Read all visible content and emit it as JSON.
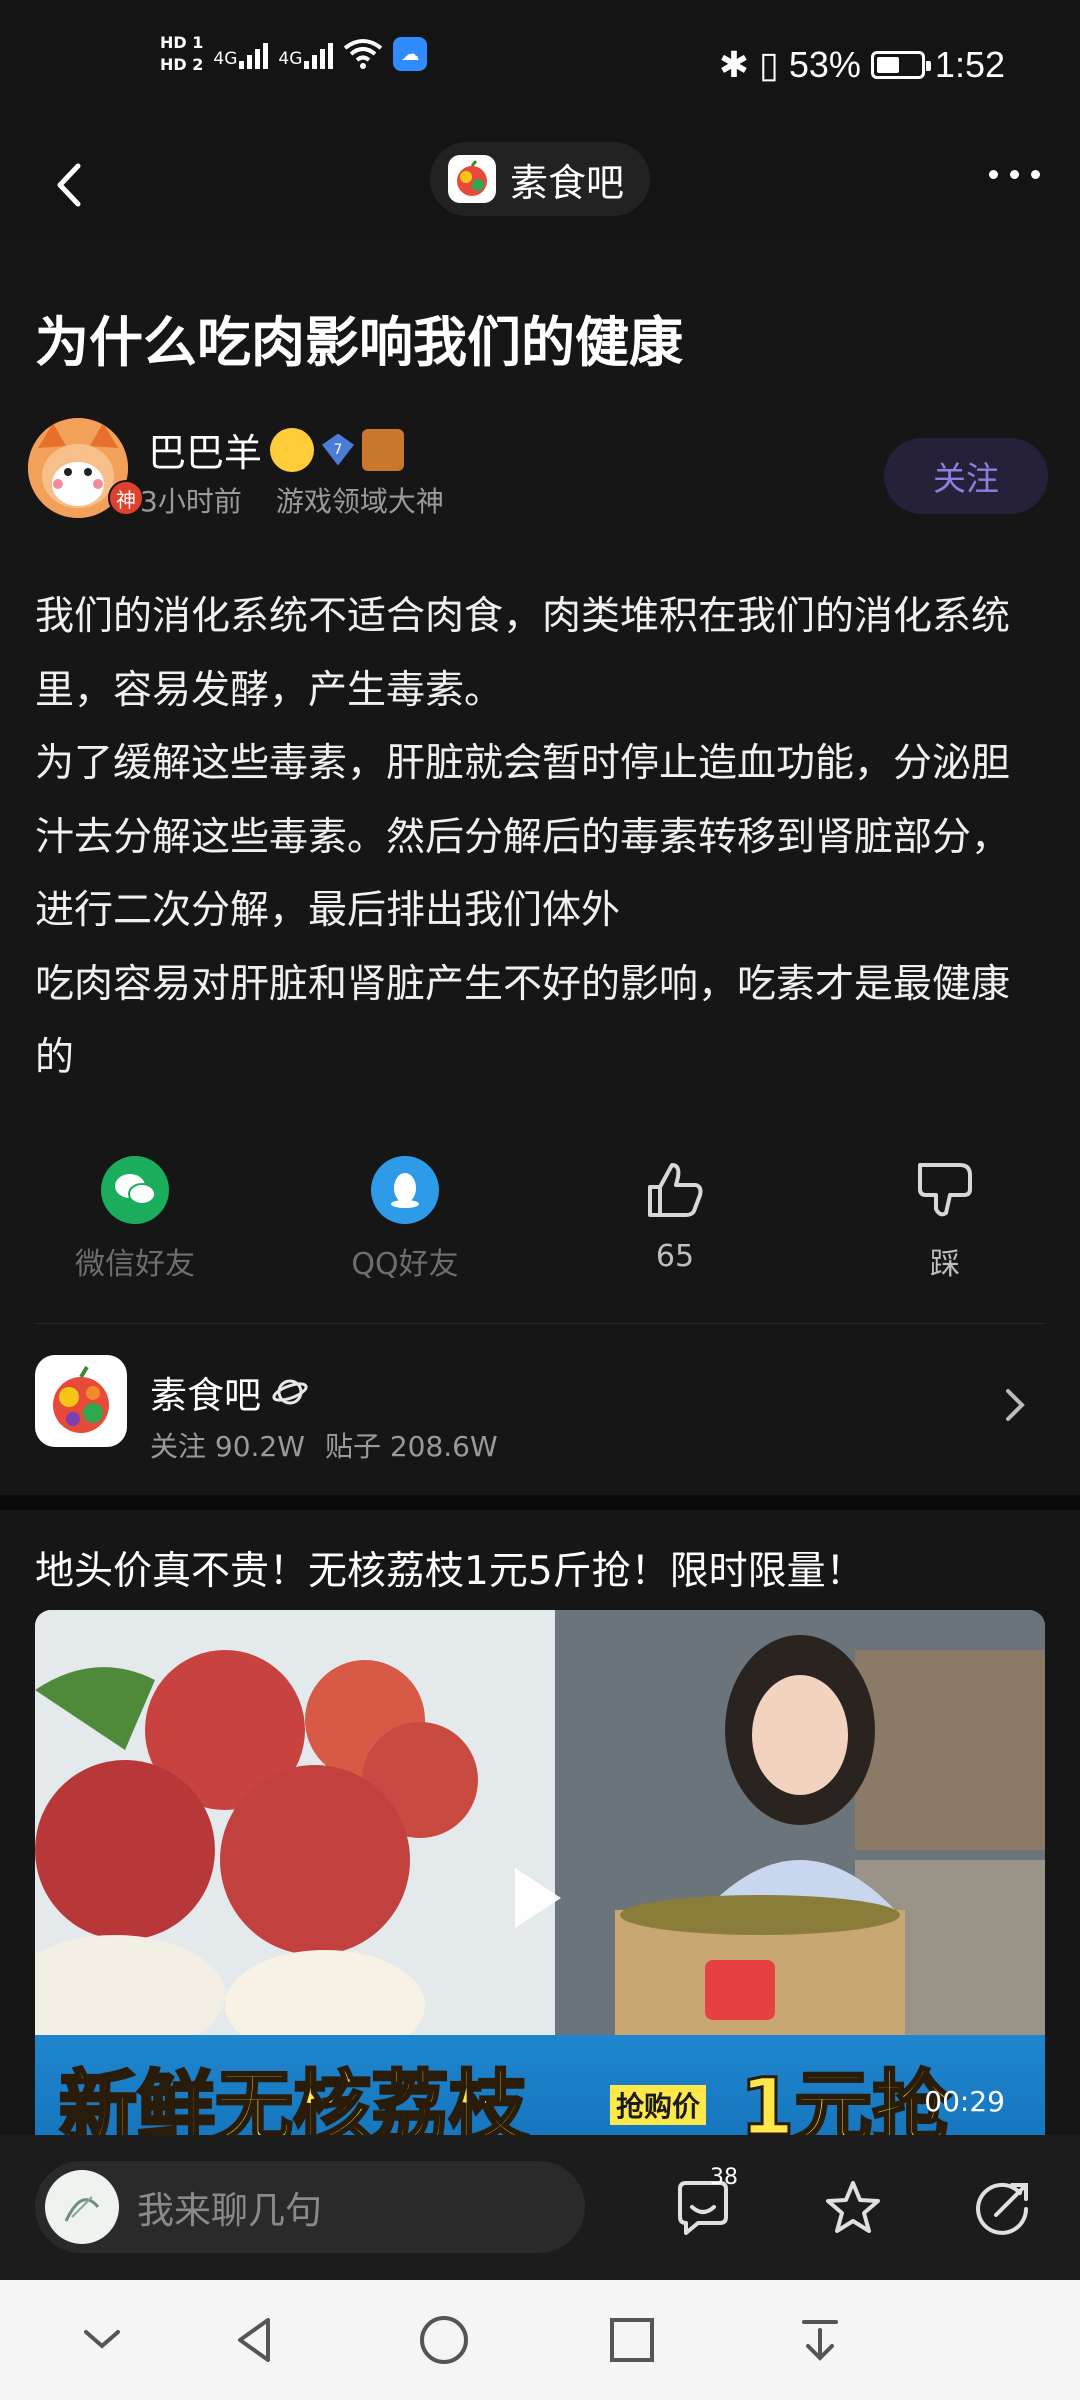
{
  "status_bar": {
    "hd1": "HD 1",
    "hd2": "HD 2",
    "network1": "4G",
    "network2": "4G",
    "battery_percent": "53%",
    "battery_level": 0.53,
    "time": "1:52"
  },
  "nav": {
    "forum_name": "素食吧"
  },
  "post": {
    "title": "为什么吃肉影响我们的健康",
    "author": {
      "name": "巴巴羊",
      "level": "7",
      "avatar_badge": "神",
      "time": "3小时前",
      "tag": "游戏领域大神"
    },
    "follow_label": "关注",
    "paragraphs": [
      "我们的消化系统不适合肉食，肉类堆积在我们的消化系统里，容易发酵，产生毒素。",
      "为了缓解这些毒素，肝脏就会暂时停止造血功能，分泌胆汁去分解这些毒素。然后分解后的毒素转移到肾脏部分，进行二次分解，最后排出我们体外",
      "吃肉容易对肝脏和肾脏产生不好的影响，吃素才是最健康的"
    ],
    "actions": {
      "wechat": "微信好友",
      "qq": "QQ好友",
      "likes": "65",
      "dislike": "踩"
    }
  },
  "forum_card": {
    "name": "素食吧",
    "followers": "关注 90.2W",
    "posts": "贴子 208.6W"
  },
  "ad": {
    "title": "地头价真不贵！无核荔枝1元5斤抢！限时限量！",
    "banner_main": "新鲜无核荔枝",
    "banner_small": "抢购价",
    "banner_price": "1元抢",
    "duration": "00:29"
  },
  "comment_bar": {
    "placeholder": "我来聊几句",
    "comment_count": "38"
  },
  "colors": {
    "background": "#121212",
    "follow_text": "#8c7fe0",
    "wechat": "#1aad5b",
    "qq": "#2d9be8"
  }
}
